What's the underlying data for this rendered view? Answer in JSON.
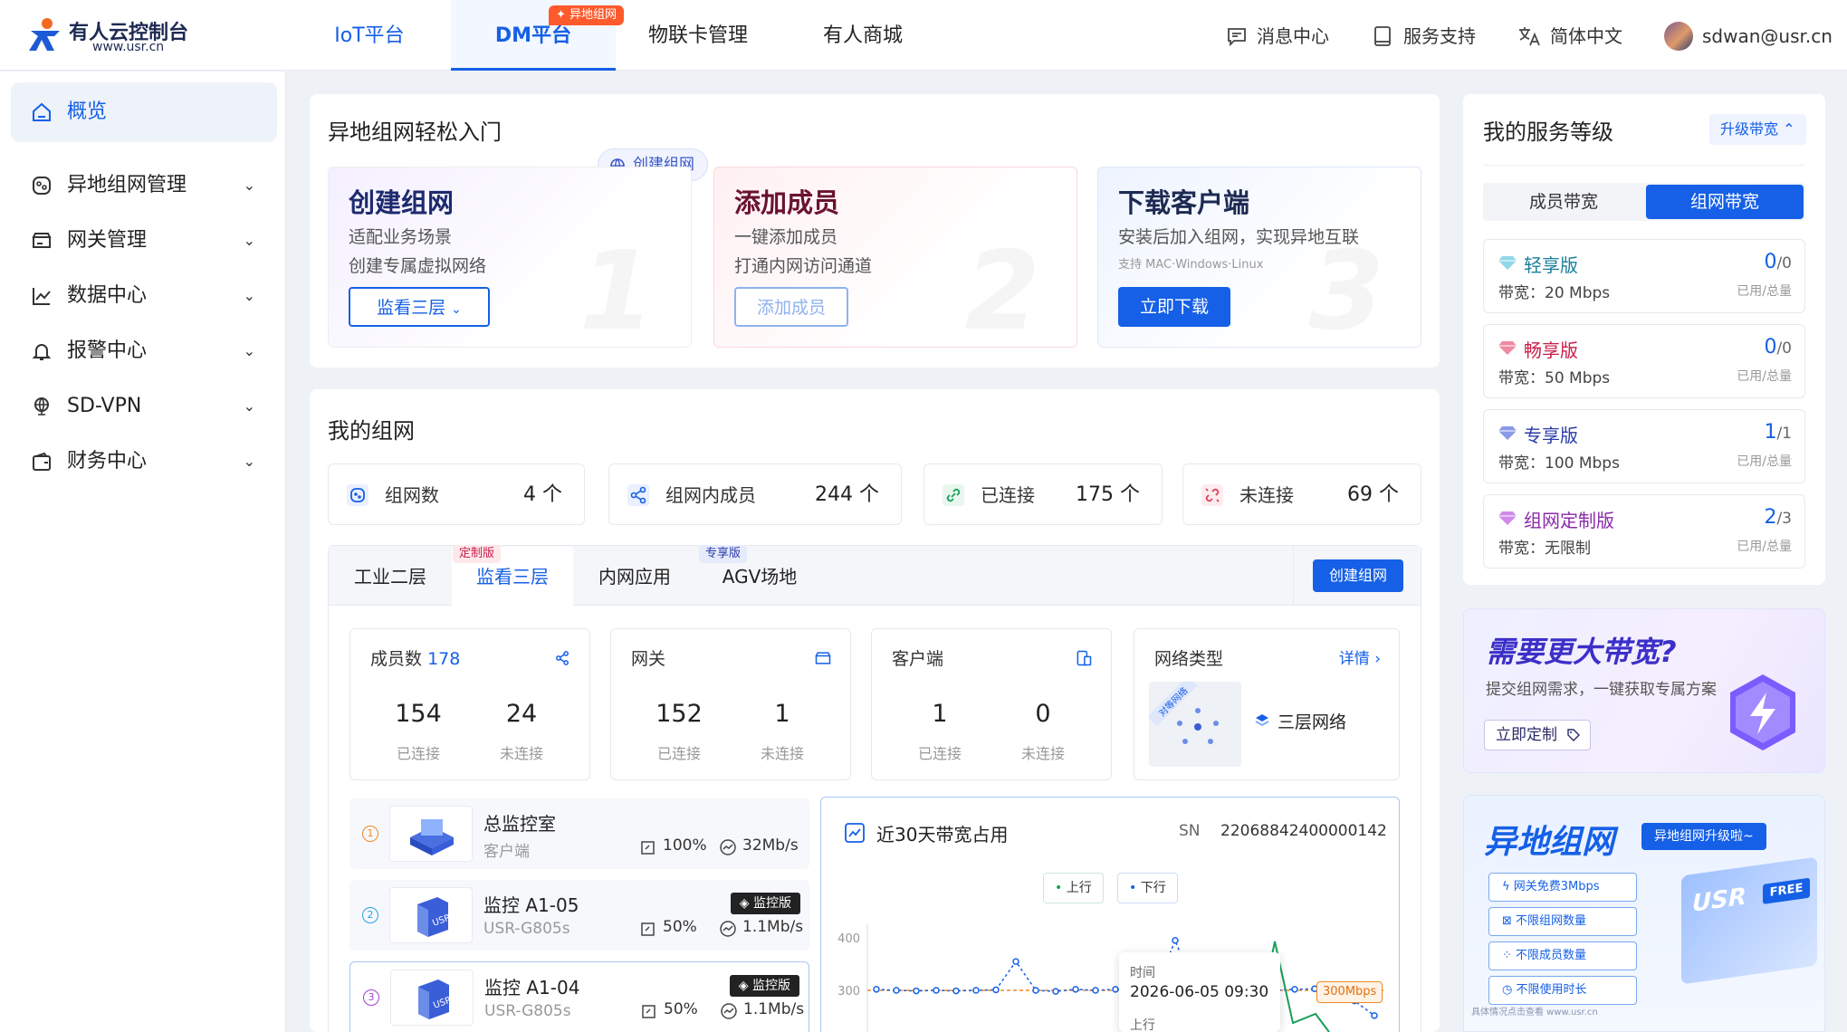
{
  "brand": {
    "name": "有人云控制台",
    "url": "www.usr.cn"
  },
  "nav": {
    "tabs": [
      {
        "label": "IoT平台"
      },
      {
        "label": "DM平台",
        "badge": "✦ 异地组网"
      },
      {
        "label": "物联卡管理"
      },
      {
        "label": "有人商城"
      }
    ]
  },
  "header": {
    "messages": "消息中心",
    "support": "服务支持",
    "language": "简体中文",
    "user": "sdwan@usr.cn"
  },
  "sidebar": {
    "items": [
      {
        "label": "概览"
      },
      {
        "label": "异地组网管理"
      },
      {
        "label": "网关管理"
      },
      {
        "label": "数据中心"
      },
      {
        "label": "报警中心"
      },
      {
        "label": "SD-VPN"
      },
      {
        "label": "财务中心"
      }
    ]
  },
  "quickstart": {
    "title": "异地组网轻松入门",
    "create_chip": "创建组网",
    "cards": [
      {
        "title": "创建组网",
        "line1": "适配业务场景",
        "line2": "创建专属虚拟网络",
        "button": "监看三层",
        "num": "1"
      },
      {
        "title": "添加成员",
        "line1": "一键添加成员",
        "line2": "打通内网访问通道",
        "button": "添加成员",
        "num": "2"
      },
      {
        "title": "下载客户端",
        "line1": "安装后加入组网，实现异地互联",
        "line2": "支持 MAC·Windows·Linux",
        "button": "立即下载",
        "num": "3"
      }
    ]
  },
  "mynet": {
    "title": "我的组网",
    "stats": [
      {
        "label": "组网数",
        "value": "4",
        "unit": "个"
      },
      {
        "label": "组网内成员",
        "value": "244",
        "unit": "个"
      },
      {
        "label": "已连接",
        "value": "175",
        "unit": "个"
      },
      {
        "label": "未连接",
        "value": "69",
        "unit": "个"
      }
    ],
    "tabs": [
      {
        "label": "工业二层"
      },
      {
        "label": "监看三层",
        "badge": "定制版"
      },
      {
        "label": "内网应用"
      },
      {
        "label": "AGV场地",
        "badge": "专享版"
      }
    ],
    "create_button": "创建组网",
    "members": {
      "title": "成员数",
      "count": "178",
      "a": "154",
      "a_label": "已连接",
      "b": "24",
      "b_label": "未连接"
    },
    "gateway": {
      "title": "网关",
      "a": "152",
      "a_label": "已连接",
      "b": "1",
      "b_label": "未连接"
    },
    "client": {
      "title": "客户端",
      "a": "1",
      "a_label": "已连接",
      "b": "0",
      "b_label": "未连接"
    },
    "nettype": {
      "title": "网络类型",
      "detail": "详情",
      "value": "三层网络",
      "corner": "对等网络"
    },
    "devices": [
      {
        "index": "1",
        "name": "总监控室",
        "sub": "客户端",
        "pct": "100%",
        "speed": "32Mb/s",
        "tag": ""
      },
      {
        "index": "2",
        "name": "监控 A1-05",
        "sub": "USR-G805s",
        "pct": "50%",
        "speed": "1.1Mb/s",
        "tag": "监控版"
      },
      {
        "index": "3",
        "name": "监控 A1-04",
        "sub": "USR-G805s",
        "pct": "50%",
        "speed": "1.1Mb/s",
        "tag": "监控版"
      }
    ]
  },
  "bandwidth": {
    "title": "近30天带宽占用",
    "sn_label": "SN",
    "sn": "22068842400000142",
    "legend_up": "上行",
    "legend_down": "下行",
    "threshold_label": "300Mbps",
    "tooltip": {
      "time_label": "时间",
      "time": "2026-06-05 09:30",
      "up_label": "上行"
    }
  },
  "chart_data": {
    "type": "line",
    "title": "近30天带宽占用",
    "ylim": [
      0,
      450
    ],
    "yticks": [
      300,
      400
    ],
    "threshold": 300,
    "series": [
      {
        "name": "上行",
        "color": "#1560e6",
        "values": [
          302,
          300,
          299,
          300,
          299,
          300,
          301,
          355,
          300,
          298,
          302,
          300,
          302,
          300,
          302,
          395,
          298,
          300,
          299,
          298,
          300,
          302,
          303,
          300,
          280,
          252
        ]
      },
      {
        "name": "下行",
        "color": "#18a058",
        "values": [
          null,
          null,
          null,
          null,
          null,
          null,
          null,
          null,
          null,
          null,
          null,
          null,
          null,
          null,
          null,
          null,
          null,
          null,
          null,
          null,
          null,
          null,
          null,
          null,
          null,
          null
        ]
      }
    ]
  },
  "service": {
    "title": "我的服务等级",
    "upgrade": "升级带宽",
    "toggle": [
      "成员带宽",
      "组网带宽"
    ],
    "bw_label": "带宽：",
    "used_label": "已用/总量",
    "tiers": [
      {
        "name": "轻享版",
        "bw": "20 Mbps",
        "used": "0",
        "total": "/0",
        "color": "#1a7f9c"
      },
      {
        "name": "畅享版",
        "bw": "50 Mbps",
        "used": "0",
        "total": "/0",
        "color": "#c81e4a"
      },
      {
        "name": "专享版",
        "bw": "100 Mbps",
        "used": "1",
        "total": "/1",
        "color": "#2a3aa8"
      },
      {
        "name": "组网定制版",
        "bw": "无限制",
        "used": "2",
        "total": "/3",
        "color": "#8a2aa8"
      }
    ]
  },
  "promo1": {
    "title": "需要更大带宽?",
    "desc": "提交组网需求，一键获取专属方案",
    "button": "立即定制"
  },
  "promo2": {
    "title": "异地组网",
    "ribbon": "异地组网升级啦~",
    "features": [
      "网关免费3Mbps",
      "不限组网数量",
      "不限成员数量",
      "不限使用时长"
    ],
    "logo_text": "USR",
    "free": "FREE",
    "foot": "具体情况点击查看 www.usr.cn"
  },
  "colors": {
    "accent": "#1560e6",
    "hot": "#ff5a2c",
    "up": "#1560e6",
    "down": "#18a058",
    "threshold": "#f08a24"
  }
}
